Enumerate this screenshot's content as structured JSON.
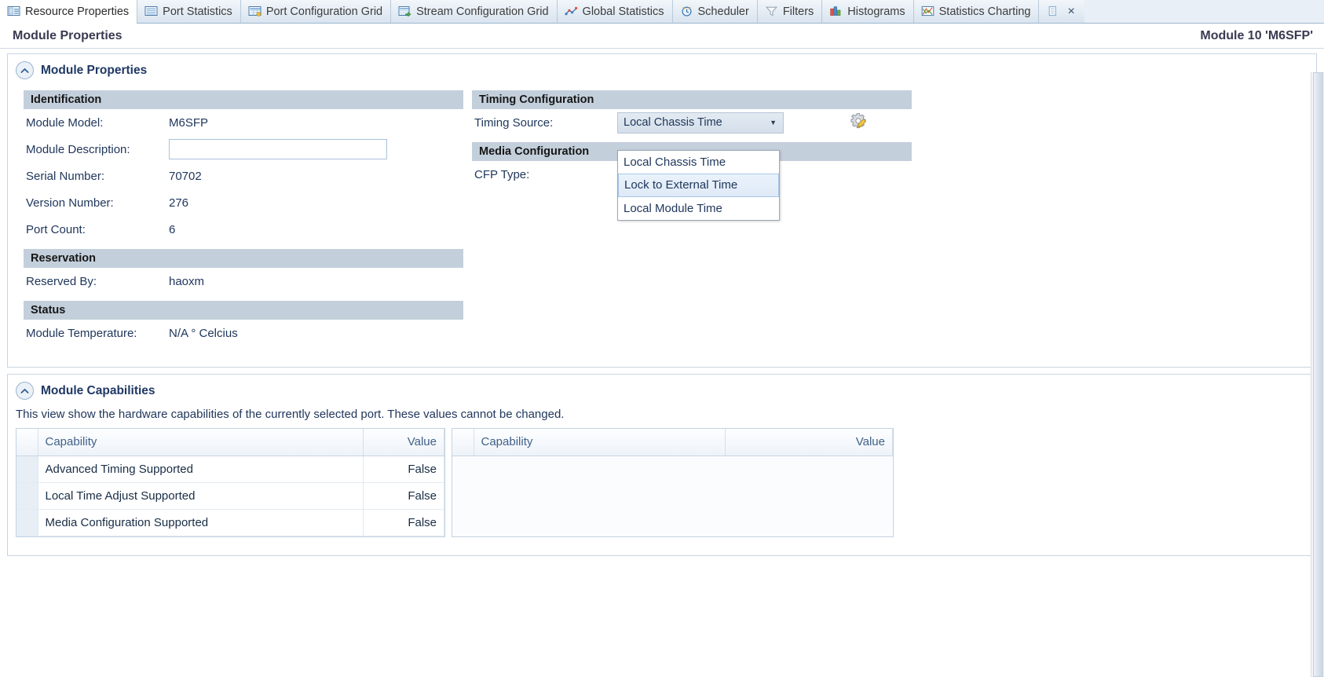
{
  "tabs": [
    {
      "label": "Resource Properties",
      "icon": "resource-properties-icon",
      "active": true
    },
    {
      "label": "Port Statistics",
      "icon": "port-statistics-icon",
      "active": false
    },
    {
      "label": "Port Configuration Grid",
      "icon": "port-configuration-grid-icon",
      "active": false
    },
    {
      "label": "Stream Configuration Grid",
      "icon": "stream-configuration-grid-icon",
      "active": false
    },
    {
      "label": "Global Statistics",
      "icon": "global-statistics-icon",
      "active": false
    },
    {
      "label": "Scheduler",
      "icon": "scheduler-clock-icon",
      "active": false
    },
    {
      "label": "Filters",
      "icon": "filter-funnel-icon",
      "active": false
    },
    {
      "label": "Histograms",
      "icon": "histograms-bar-icon",
      "active": false
    },
    {
      "label": "Statistics Charting",
      "icon": "statistics-charting-icon",
      "active": false
    }
  ],
  "tab_close_label": "×",
  "header": {
    "title": "Module Properties",
    "module_label": "Module 10 'M6SFP'"
  },
  "properties_panel": {
    "title": "Module Properties",
    "identification": {
      "group_title": "Identification",
      "rows": [
        {
          "label": "Module Model:",
          "value": "M6SFP"
        },
        {
          "label": "Module Description:",
          "value": "",
          "placeholder": ""
        },
        {
          "label": "Serial Number:",
          "value": "70702"
        },
        {
          "label": "Version Number:",
          "value": "276"
        },
        {
          "label": "Port Count:",
          "value": "6"
        }
      ]
    },
    "reservation": {
      "group_title": "Reservation",
      "rows": [
        {
          "label": "Reserved By:",
          "value": "haoxm"
        }
      ]
    },
    "status": {
      "group_title": "Status",
      "rows": [
        {
          "label": "Module Temperature:",
          "value": "N/A ° Celcius"
        }
      ]
    },
    "timing": {
      "group_title": "Timing Configuration",
      "timing_source_label": "Timing Source:",
      "timing_source_value": "Local Chassis Time",
      "timing_source_options": [
        "Local Chassis Time",
        "Lock to External Time",
        "Local Module Time"
      ],
      "timing_source_highlighted": "Lock to External Time",
      "caret": "▼"
    },
    "media": {
      "group_title": "Media Configuration",
      "cfp_label": "CFP Type:",
      "cfp_value": ""
    }
  },
  "capabilities_panel": {
    "title": "Module Capabilities",
    "note": "This view show the hardware capabilities of the currently selected port. These values cannot be changed.",
    "left_table": {
      "columns": [
        "Capability",
        "Value"
      ],
      "rows": [
        {
          "capability": "Advanced Timing Supported",
          "value": "False"
        },
        {
          "capability": "Local Time Adjust Supported",
          "value": "False"
        },
        {
          "capability": "Media Configuration Supported",
          "value": "False"
        }
      ]
    },
    "right_table": {
      "columns": [
        "Capability",
        "Value"
      ],
      "rows": []
    }
  },
  "colors": {
    "group_header_bg": "#c3cfdb",
    "accent_text": "#1f3864",
    "tab_active_bg": "#ffffff"
  }
}
